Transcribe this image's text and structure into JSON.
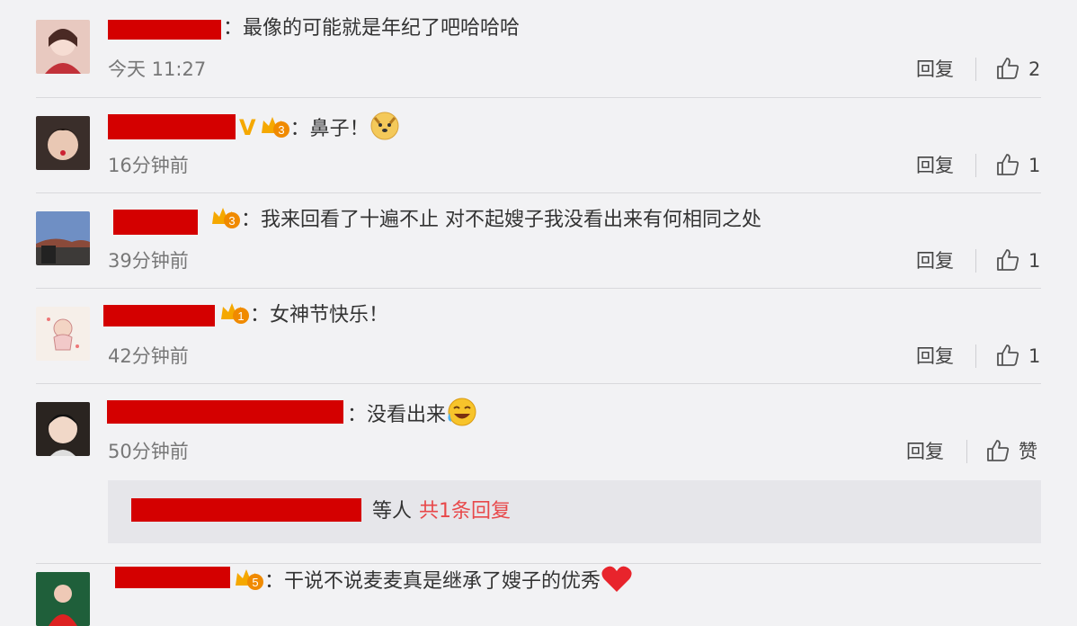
{
  "comments": [
    {
      "text": "：最像的可能就是年纪了吧哈哈哈",
      "time": "今天 11:27",
      "reply": "回复",
      "likes": "2",
      "avatar": "girl-portrait-red"
    },
    {
      "text": "：鼻子！",
      "time": "16分钟前",
      "reply": "回复",
      "likes": "1",
      "badge_level": "3",
      "verified": "V",
      "avatar": "child-portrait"
    },
    {
      "text": "：我来回看了十遍不止 对不起嫂子我没看出来有何相同之处",
      "time": "39分钟前",
      "reply": "回复",
      "likes": "1",
      "badge_level": "3",
      "avatar": "landscape-photo"
    },
    {
      "text": "：女神节快乐！",
      "time": "42分钟前",
      "reply": "回复",
      "likes": "1",
      "badge_level": "1",
      "avatar": "cartoon-drawing"
    },
    {
      "text": "：没看出来",
      "time": "50分钟前",
      "reply": "回复",
      "likes": "赞",
      "avatar": "woman-portrait"
    },
    {
      "text": "：干说不说麦麦真是继承了嫂子的优秀",
      "badge_level": "5",
      "avatar": "woman-red-portrait"
    }
  ],
  "subreply": {
    "suffix": "等人",
    "count_text": "共1条回复"
  },
  "colors": {
    "background": "#f2f2f4",
    "redaction": "#d40000",
    "accent": "#e8484a",
    "badge_orange": "#f5a800"
  }
}
